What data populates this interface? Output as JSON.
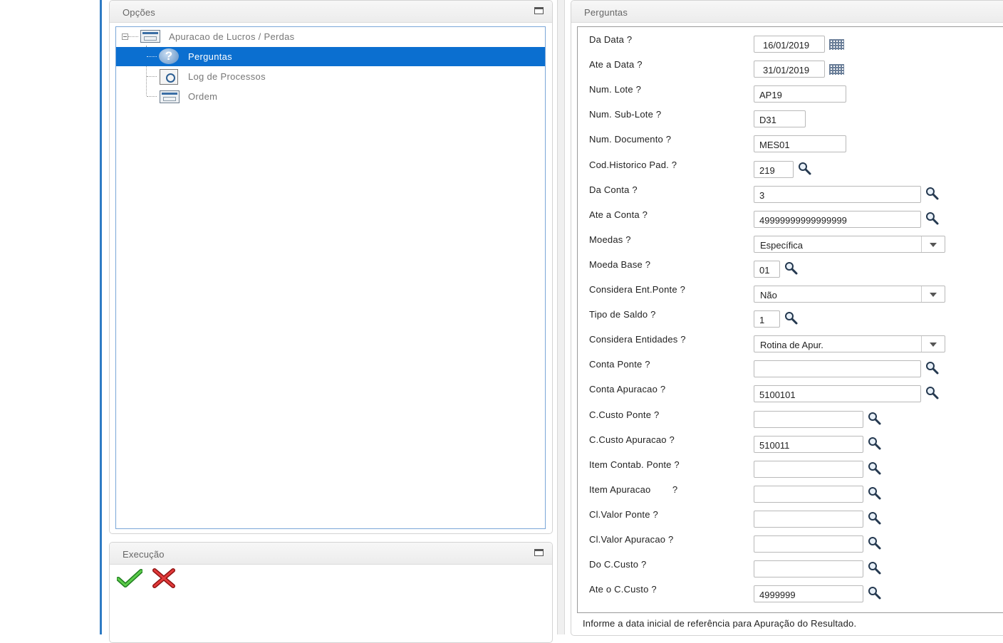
{
  "options_panel": {
    "title": "Opções",
    "tree": {
      "root": "Apuracao de Lucros / Perdas",
      "children": [
        "Perguntas",
        "Log de Processos",
        "Ordem"
      ],
      "selected": "Perguntas"
    }
  },
  "execution_panel": {
    "title": "Execução",
    "confirm_icon": "check-icon",
    "cancel_icon": "x-icon"
  },
  "questions_panel": {
    "title": "Perguntas",
    "fields": [
      {
        "label": "Da Data ?",
        "value": "16/01/2019",
        "type": "date"
      },
      {
        "label": "Ate a Data ?",
        "value": "31/01/2019",
        "type": "date"
      },
      {
        "label": "Num. Lote ?",
        "value": "AP19",
        "type": "text"
      },
      {
        "label": "Num. Sub-Lote ?",
        "value": "D31",
        "type": "text"
      },
      {
        "label": "Num. Documento ?",
        "value": "MES01",
        "type": "text"
      },
      {
        "label": "Cod.Historico Pad. ?",
        "value": "219",
        "type": "lookup"
      },
      {
        "label": "Da Conta ?",
        "value": "3",
        "type": "lookup"
      },
      {
        "label": "Ate a Conta ?",
        "value": "49999999999999999",
        "type": "lookup"
      },
      {
        "label": "Moedas ?",
        "value": "Específica",
        "type": "select"
      },
      {
        "label": "Moeda Base ?",
        "value": "01",
        "type": "lookup"
      },
      {
        "label": "Considera Ent.Ponte ?",
        "value": "Não",
        "type": "select"
      },
      {
        "label": "Tipo de Saldo ?",
        "value": "1",
        "type": "lookup"
      },
      {
        "label": "Considera Entidades ?",
        "value": "Rotina de Apur.",
        "type": "select"
      },
      {
        "label": "Conta Ponte ?",
        "value": "",
        "type": "lookup"
      },
      {
        "label": "Conta Apuracao ?",
        "value": "5100101",
        "type": "lookup"
      },
      {
        "label": "C.Custo Ponte ?",
        "value": "",
        "type": "lookup"
      },
      {
        "label": "C.Custo Apuracao ?",
        "value": "510011",
        "type": "lookup"
      },
      {
        "label": "Item Contab. Ponte ?",
        "value": "",
        "type": "lookup"
      },
      {
        "label": "Item Apuracao        ?",
        "value": "",
        "type": "lookup"
      },
      {
        "label": "Cl.Valor Ponte ?",
        "value": "",
        "type": "lookup"
      },
      {
        "label": "Cl.Valor Apuracao ?",
        "value": "",
        "type": "lookup"
      },
      {
        "label": "Do C.Custo ?",
        "value": "",
        "type": "lookup"
      },
      {
        "label": "Ate o C.Custo ?",
        "value": "4999999",
        "type": "lookup"
      }
    ],
    "help_text": "Informe a data inicial de referência para Apuração do Resultado."
  },
  "colors": {
    "selection": "#0b6fd0",
    "accent_line": "#2f7bc4",
    "confirm": "#2a9d2a",
    "cancel": "#d01c1c"
  }
}
